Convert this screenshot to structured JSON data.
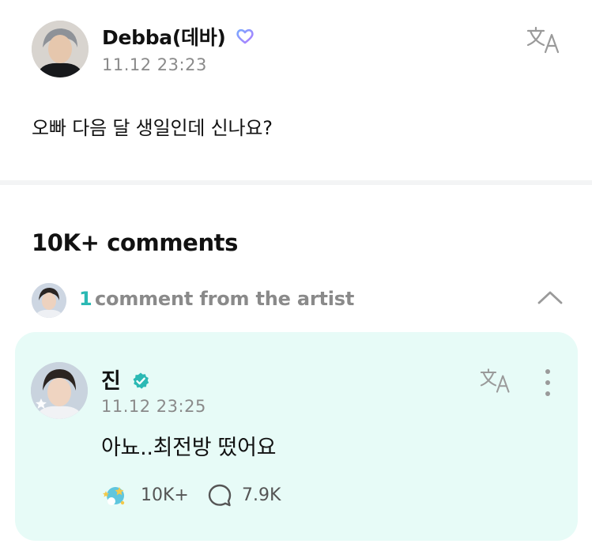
{
  "post": {
    "author": "Debba(데바)",
    "timestamp": "11.12 23:23",
    "text": "오빠 다음 달 생일인데 신나요?"
  },
  "comments": {
    "count_label": "10K+ comments",
    "artist_count": "1",
    "artist_label": "comment from the artist"
  },
  "artist_comment": {
    "author": "진",
    "timestamp": "11.12 23:25",
    "text": "아뇨..최전방 떴어요",
    "likes": "10K+",
    "replies": "7.9K"
  },
  "icons": {
    "translate": "translate-icon",
    "more": "more-vertical-icon",
    "like": "cheer-sticker-icon",
    "reply": "speech-bubble-icon",
    "collapse": "chevron-up-icon",
    "badge": "heart-badge-icon",
    "verified": "verified-badge-icon"
  },
  "colors": {
    "accent": "#2bb9b4",
    "card_bg": "#e7fbf7",
    "muted_text": "#8a8a8a"
  }
}
